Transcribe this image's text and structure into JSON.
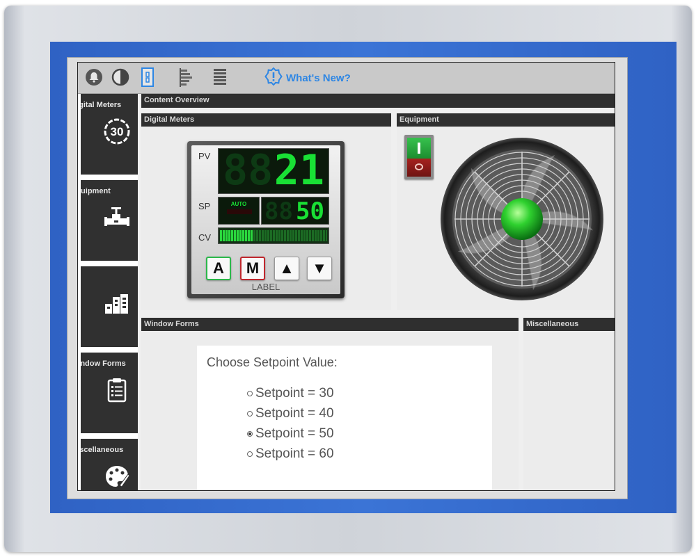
{
  "toolbar": {
    "icons": [
      "bell-icon",
      "contrast-icon",
      "door-icon",
      "flag-stack-icon",
      "list-lines-icon"
    ],
    "whats_new_label": "What's New?",
    "accent_color": "#2d86e4"
  },
  "sidebar": {
    "items": [
      {
        "label": "Digital Meters",
        "icon": "gauge-30-icon"
      },
      {
        "label": "Equipment",
        "icon": "valve-pipe-icon"
      },
      {
        "label": "",
        "icon": "building-icon"
      },
      {
        "label": "Window Forms",
        "icon": "clipboard-icon"
      },
      {
        "label": "Miscellaneous",
        "icon": "palette-icon"
      }
    ]
  },
  "main": {
    "content_header": "Content Overview",
    "panels": {
      "digital_meters": "Digital Meters",
      "equipment": "Equipment",
      "window_forms": "Window Forms",
      "miscellaneous": "Miscellaneous"
    }
  },
  "meter": {
    "pv_label": "PV",
    "pv_value": "21",
    "sp_label": "SP",
    "sp_value": "50",
    "mode": "AUTO",
    "cv_label": "CV",
    "cv_fill_fraction": 0.3,
    "buttons": {
      "auto": "A",
      "manual": "M",
      "up": "▲",
      "down": "▼"
    },
    "label": "LABEL",
    "lcd_color": "#19e035"
  },
  "equipment": {
    "switch_state": "on",
    "fan_status_color": "#2fd12f"
  },
  "form": {
    "title": "Choose Setpoint Value:",
    "options": [
      {
        "label": "Setpoint = 30",
        "selected": false
      },
      {
        "label": "Setpoint = 40",
        "selected": false
      },
      {
        "label": "Setpoint = 50",
        "selected": true
      },
      {
        "label": "Setpoint = 60",
        "selected": false
      }
    ]
  }
}
